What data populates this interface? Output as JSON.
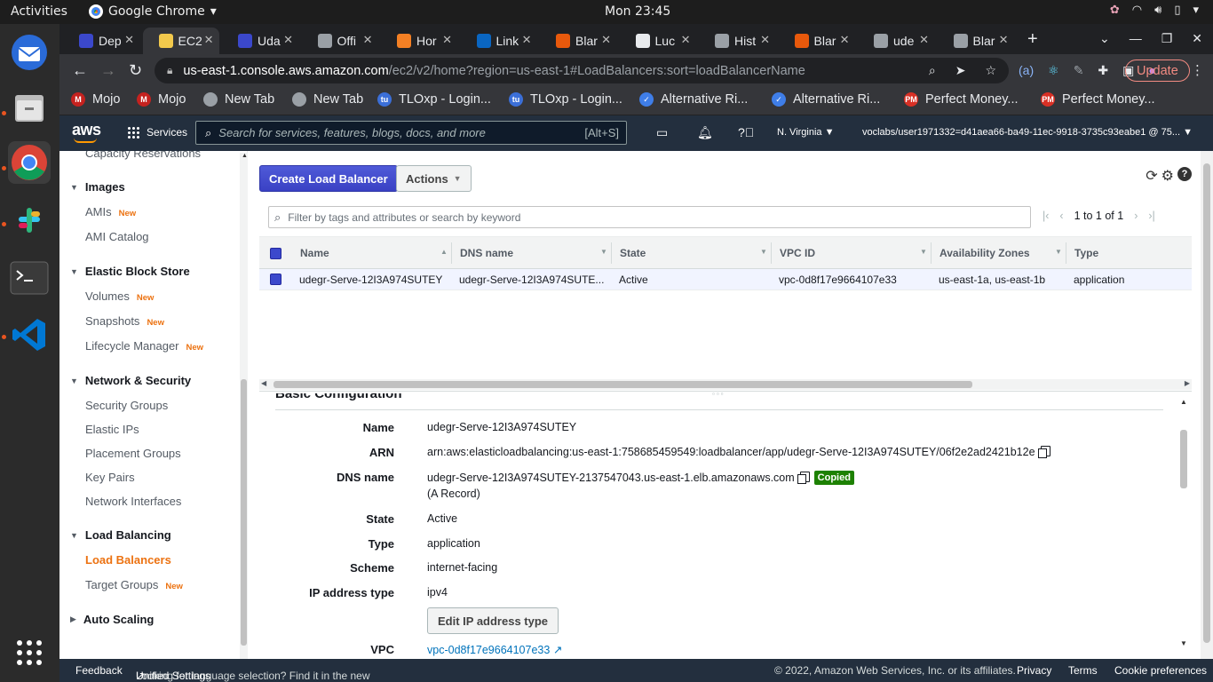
{
  "system": {
    "activities": "Activities",
    "app_menu": "Google Chrome",
    "clock": "Mon 23:45"
  },
  "browser": {
    "tabs": [
      {
        "label": "Dep",
        "icon": "udemy-icon",
        "color": "#3b48cc"
      },
      {
        "label": "EC2",
        "icon": "aws-ec2-icon",
        "color": "#f2c94c",
        "active": true
      },
      {
        "label": "Uda",
        "icon": "udemy-icon",
        "color": "#3b48cc"
      },
      {
        "label": "Offi",
        "icon": "globe-icon",
        "color": "#9aa0a6"
      },
      {
        "label": "Hor",
        "icon": "udemy-icon",
        "color": "#f48024"
      },
      {
        "label": "Link",
        "icon": "linkedin-icon",
        "color": "#0a66c2"
      },
      {
        "label": "Blar",
        "icon": "blackboard-icon",
        "color": "#e8590c"
      },
      {
        "label": "Luc",
        "icon": "lucid-icon",
        "color": "#e8eaed"
      },
      {
        "label": "Hist",
        "icon": "history-icon",
        "color": "#9aa0a6"
      },
      {
        "label": "Blar",
        "icon": "blackboard-icon",
        "color": "#e8590c"
      },
      {
        "label": "ude",
        "icon": "globe-icon",
        "color": "#9aa0a6"
      },
      {
        "label": "Blar",
        "icon": "globe-icon",
        "color": "#9aa0a6"
      }
    ],
    "url_host": "us-east-1.console.aws.amazon.com",
    "url_path": "/ec2/v2/home?region=us-east-1#LoadBalancers:sort=loadBalancerName",
    "update_label": "Update",
    "bookmarks": [
      {
        "label": "Mojo",
        "color": "#c5221f",
        "glyph": "M"
      },
      {
        "label": "Mojo",
        "color": "#c5221f",
        "glyph": "M"
      },
      {
        "label": "New Tab",
        "color": "#9aa0a6",
        "glyph": ""
      },
      {
        "label": "New Tab",
        "color": "#9aa0a6",
        "glyph": ""
      },
      {
        "label": "TLOxp - Login...",
        "color": "#3b6fd8",
        "glyph": "tu"
      },
      {
        "label": "TLOxp - Login...",
        "color": "#3b6fd8",
        "glyph": "tu"
      },
      {
        "label": "Alternative Ri...",
        "color": "#3f7ee8",
        "glyph": "✓"
      },
      {
        "label": "Alternative Ri...",
        "color": "#3f7ee8",
        "glyph": "✓"
      },
      {
        "label": "Perfect Money...",
        "color": "#d93025",
        "glyph": "PM"
      },
      {
        "label": "Perfect Money...",
        "color": "#d93025",
        "glyph": "PM"
      }
    ]
  },
  "aws": {
    "logo": "aws",
    "services_label": "Services",
    "search_placeholder": "Search for services, features, blogs, docs, and more",
    "search_shortcut": "[Alt+S]",
    "region": "N. Virginia ▼",
    "account": "voclabs/user1971332=d41aea66-ba49-11ec-9918-3735c93eabe1 @ 75... ▼"
  },
  "sidebar": {
    "top_item": "Capacity Reservations",
    "sections": [
      {
        "title": "Images",
        "items": [
          {
            "label": "AMIs",
            "new": "New"
          },
          {
            "label": "AMI Catalog",
            "new": ""
          }
        ]
      },
      {
        "title": "Elastic Block Store",
        "items": [
          {
            "label": "Volumes",
            "new": "New"
          },
          {
            "label": "Snapshots",
            "new": "New"
          },
          {
            "label": "Lifecycle Manager",
            "new": "New"
          }
        ]
      },
      {
        "title": "Network & Security",
        "items": [
          {
            "label": "Security Groups",
            "new": ""
          },
          {
            "label": "Elastic IPs",
            "new": ""
          },
          {
            "label": "Placement Groups",
            "new": ""
          },
          {
            "label": "Key Pairs",
            "new": ""
          },
          {
            "label": "Network Interfaces",
            "new": ""
          }
        ]
      },
      {
        "title": "Load Balancing",
        "items": [
          {
            "label": "Load Balancers",
            "new": "",
            "active": true
          },
          {
            "label": "Target Groups",
            "new": "New"
          }
        ]
      },
      {
        "title": "Auto Scaling",
        "items": []
      }
    ]
  },
  "main": {
    "create_button": "Create Load Balancer",
    "actions_button": "Actions",
    "filter_placeholder": "Filter by tags and attributes or search by keyword",
    "pager_text": "1 to 1 of 1",
    "columns": [
      "Name",
      "DNS name",
      "State",
      "VPC ID",
      "Availability Zones",
      "Type"
    ],
    "rows": [
      [
        "udegr-Serve-12I3A974SUTEY",
        "udegr-Serve-12I3A974SUTE...",
        "Active",
        "vpc-0d8f17e9664107e33",
        "us-east-1a, us-east-1b",
        "application"
      ]
    ]
  },
  "details": {
    "section_title": "Basic Configuration",
    "name_label": "Name",
    "name_value": "udegr-Serve-12I3A974SUTEY",
    "arn_label": "ARN",
    "arn_value": "arn:aws:elasticloadbalancing:us-east-1:758685459549:loadbalancer/app/udegr-Serve-12I3A974SUTEY/06f2e2ad2421b12e",
    "dns_label": "DNS name",
    "dns_value": "udegr-Serve-12I3A974SUTEY-2137547043.us-east-1.elb.amazonaws.com",
    "dns_copied": "Copied",
    "dns_record": "(A Record)",
    "state_label": "State",
    "state_value": "Active",
    "type_label": "Type",
    "type_value": "application",
    "scheme_label": "Scheme",
    "scheme_value": "internet-facing",
    "iptype_label": "IP address type",
    "iptype_value": "ipv4",
    "edit_ip_button": "Edit IP address type",
    "vpc_label": "VPC",
    "vpc_value": "vpc-0d8f17e9664107e33"
  },
  "footer": {
    "feedback": "Feedback",
    "lang_prompt": "Looking for language selection? Find it in the new",
    "unified_settings": "Unified Settings",
    "copyright": "© 2022, Amazon Web Services, Inc. or its affiliates.",
    "privacy": "Privacy",
    "terms": "Terms",
    "cookies": "Cookie preferences"
  }
}
